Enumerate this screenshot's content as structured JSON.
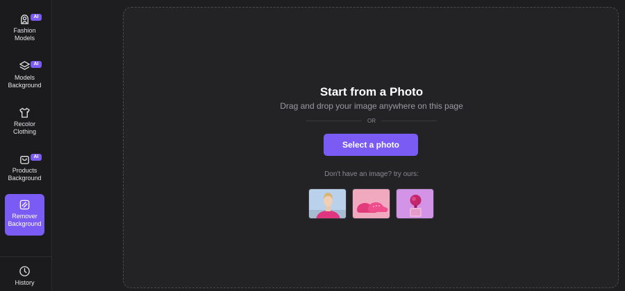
{
  "sidebar": {
    "items": [
      {
        "label": "Fashion\nModels",
        "badge": "AI",
        "icon": "hanger-person-icon"
      },
      {
        "label": "Models\nBackground",
        "badge": "AI",
        "icon": "layers-icon"
      },
      {
        "label": "Recolor\nClothing",
        "icon": "tshirt-icon"
      },
      {
        "label": "Products\nBackground",
        "badge": "AI",
        "icon": "bag-icon"
      },
      {
        "label": "Remover\nBackground",
        "icon": "remove-background-icon",
        "active": true
      },
      {
        "label": "History",
        "icon": "clock-icon"
      }
    ]
  },
  "upload": {
    "title": "Start from a Photo",
    "subtitle": "Drag and drop your image anywhere on this page",
    "or": "OR",
    "button": "Select a photo",
    "hint": "Don't have an image? try ours:"
  },
  "samples": [
    "model-portrait-sample",
    "pink-shoes-sample",
    "pink-perfume-sample"
  ],
  "colors": {
    "accent": "#7a5cf5",
    "background": "#1e1e21",
    "sidebar": "#1b1b1e",
    "dropzone": "#232326"
  }
}
